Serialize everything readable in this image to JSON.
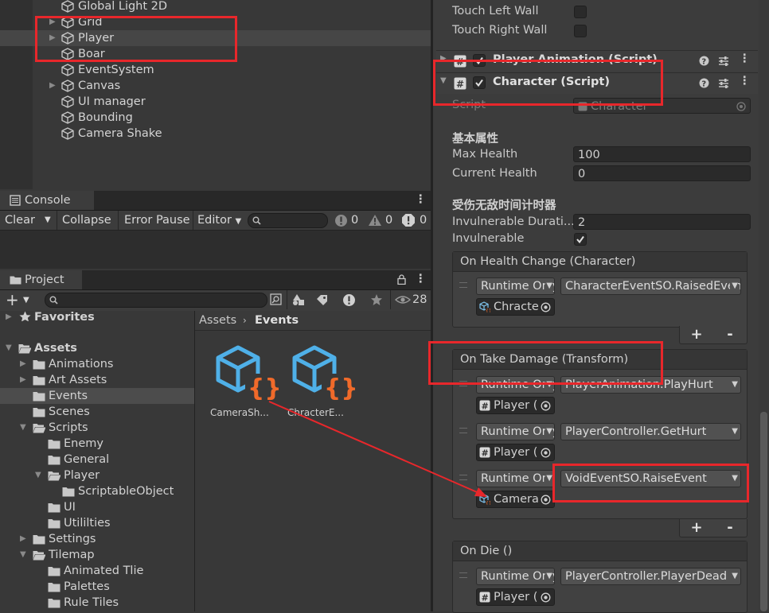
{
  "hierarchy": {
    "items": [
      {
        "label": "Global Light 2D",
        "expandable": false,
        "selected": false
      },
      {
        "label": "Grid",
        "expandable": true,
        "selected": false
      },
      {
        "label": "Player",
        "expandable": true,
        "selected": true
      },
      {
        "label": "Boar",
        "expandable": false,
        "selected": false
      },
      {
        "label": "EventSystem",
        "expandable": false,
        "selected": false
      },
      {
        "label": "Canvas",
        "expandable": true,
        "selected": false
      },
      {
        "label": "UI manager",
        "expandable": false,
        "selected": false
      },
      {
        "label": "Bounding",
        "expandable": false,
        "selected": false
      },
      {
        "label": "Camera Shake",
        "expandable": false,
        "selected": false
      }
    ]
  },
  "console": {
    "tab_label": "Console",
    "clear_label": "Clear",
    "collapse_label": "Collapse",
    "error_pause_label": "Error Pause",
    "editor_label": "Editor",
    "info_count": "0",
    "warning_count": "0",
    "error_count": "0"
  },
  "project": {
    "tab_label": "Project",
    "hidden_count": "28",
    "breadcrumb": [
      "Assets",
      "Events"
    ],
    "tree": [
      {
        "label": "Favorites",
        "indent": 0,
        "icon": "star-icon",
        "expanded": false,
        "arrow": true,
        "bold": true
      },
      {
        "label": "Assets",
        "indent": 0,
        "icon": "folder-open-icon",
        "expanded": true,
        "arrow": true,
        "bold": true
      },
      {
        "label": "Animations",
        "indent": 1,
        "icon": "folder-icon",
        "arrow": true
      },
      {
        "label": "Art Assets",
        "indent": 1,
        "icon": "folder-icon",
        "arrow": true
      },
      {
        "label": "Events",
        "indent": 1,
        "icon": "folder-icon",
        "arrow": false,
        "selected": true
      },
      {
        "label": "Scenes",
        "indent": 1,
        "icon": "folder-icon",
        "arrow": false
      },
      {
        "label": "Scripts",
        "indent": 1,
        "icon": "folder-open-icon",
        "arrow": true,
        "expanded": true
      },
      {
        "label": "Enemy",
        "indent": 2,
        "icon": "folder-icon",
        "arrow": false
      },
      {
        "label": "General",
        "indent": 2,
        "icon": "folder-icon",
        "arrow": false
      },
      {
        "label": "Player",
        "indent": 2,
        "icon": "folder-open-icon",
        "arrow": true,
        "expanded": true
      },
      {
        "label": "ScriptableObject",
        "indent": 3,
        "icon": "folder-icon",
        "arrow": false
      },
      {
        "label": "UI",
        "indent": 2,
        "icon": "folder-icon",
        "arrow": false
      },
      {
        "label": "Utililties",
        "indent": 2,
        "icon": "folder-icon",
        "arrow": false
      },
      {
        "label": "Settings",
        "indent": 1,
        "icon": "folder-icon",
        "arrow": true
      },
      {
        "label": "Tilemap",
        "indent": 1,
        "icon": "folder-open-icon",
        "arrow": true,
        "expanded": true
      },
      {
        "label": "Animated Tlie",
        "indent": 2,
        "icon": "folder-icon",
        "arrow": false
      },
      {
        "label": "Palettes",
        "indent": 2,
        "icon": "folder-icon",
        "arrow": false
      },
      {
        "label": "Rule Tiles",
        "indent": 2,
        "icon": "folder-icon",
        "arrow": false
      }
    ],
    "assets": [
      {
        "label": "CameraSh..."
      },
      {
        "label": "ChracterE..."
      }
    ]
  },
  "inspector": {
    "touch_left_wall": "Touch Left Wall",
    "touch_right_wall": "Touch Right Wall",
    "component_player_animation": "Player Animation (Script)",
    "component_character": "Character (Script)",
    "script_label": "Script",
    "script_value": "Character",
    "section_basic": "基本属性",
    "max_health_label": "Max Health",
    "max_health_value": "100",
    "current_health_label": "Current Health",
    "current_health_value": "0",
    "section_invulnerable": "受伤无敌时间计时器",
    "invulnerable_duration_label": "Invulnerable Durati...",
    "invulnerable_duration_value": "2",
    "invulnerable_label": "Invulnerable",
    "invulnerable_checked": true,
    "events": [
      {
        "title": "On Health Change (Character)",
        "listeners": [
          {
            "mode": "Runtime Only",
            "function": "CharacterEventSO.RaisedEvent",
            "object": "Chracte",
            "object_icon": "scriptable-object-icon"
          }
        ]
      },
      {
        "title": "On Take Damage (Transform)",
        "listeners": [
          {
            "mode": "Runtime Only",
            "function": "PlayerAnimation.PlayHurt",
            "object": "Player (",
            "object_icon": "script-icon"
          },
          {
            "mode": "Runtime Only",
            "function": "PlayerController.GetHurt",
            "object": "Player (",
            "object_icon": "script-icon"
          },
          {
            "mode": "Runtime Only",
            "function": "VoidEventSO.RaiseEvent",
            "object": "Camera",
            "object_icon": "scriptable-object-icon",
            "highlighted": true
          }
        ]
      },
      {
        "title": "On Die ()",
        "listeners": [
          {
            "mode": "Runtime Only",
            "function": "PlayerController.PlayerDead",
            "object": "Player (",
            "object_icon": "script-icon"
          }
        ]
      }
    ],
    "plus_label": "+",
    "minus_label": "-"
  },
  "annotation_color": "#e8272b",
  "accent_color": "#4fb0e8"
}
